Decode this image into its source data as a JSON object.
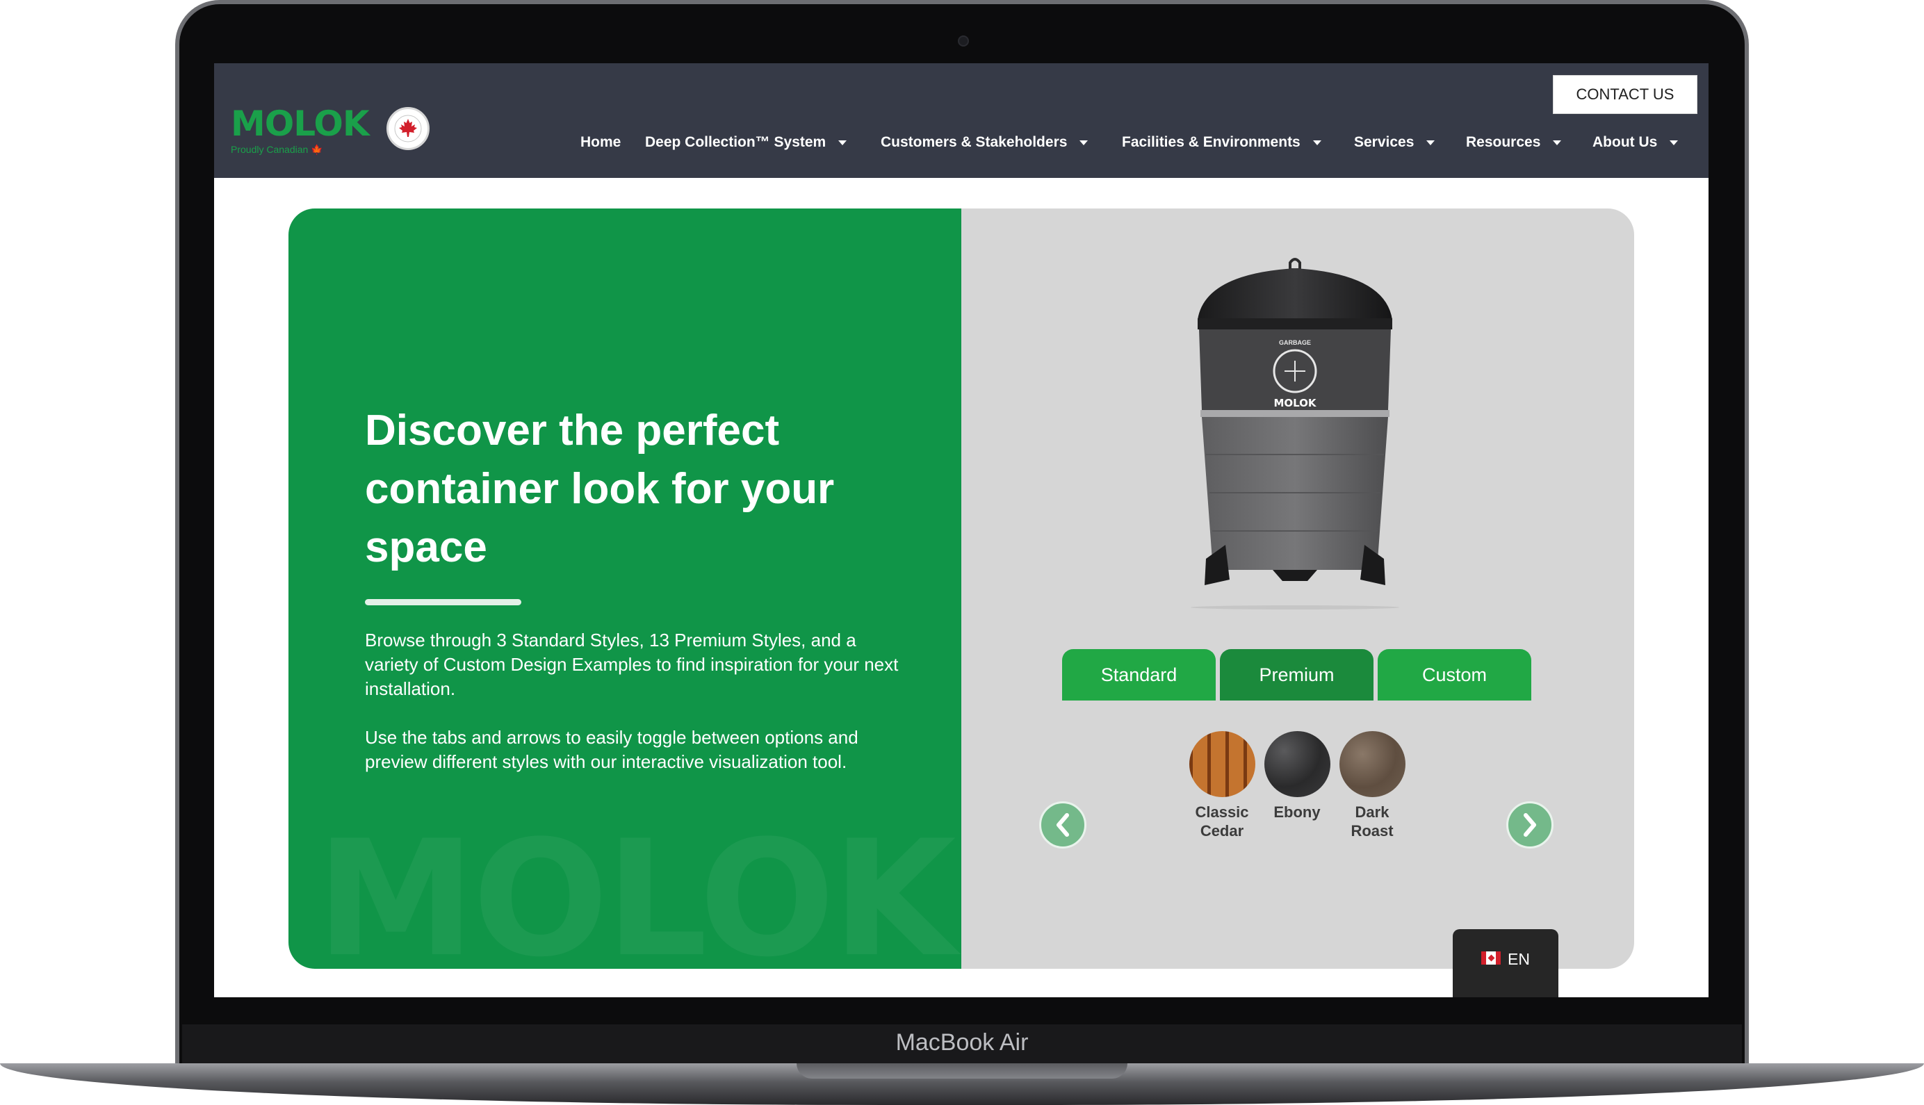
{
  "device": {
    "model": "MacBook Air"
  },
  "brand": {
    "logo_text": "MOLOK",
    "tagline": "Proudly Canadian"
  },
  "header": {
    "contact_label": "CONTACT US",
    "nav": [
      {
        "label": "Home",
        "dropdown": false
      },
      {
        "label": "Deep Collection™ System",
        "dropdown": true
      },
      {
        "label": "Customers & Stakeholders",
        "dropdown": true
      },
      {
        "label": "Facilities & Environments",
        "dropdown": true
      },
      {
        "label": "Services",
        "dropdown": true
      },
      {
        "label": "Resources",
        "dropdown": true
      },
      {
        "label": "About Us",
        "dropdown": true
      }
    ]
  },
  "hero": {
    "title": "Discover the perfect container look for your space",
    "paragraph1": "Browse through 3 Standard Styles, 13 Premium Styles, and a variety of Custom Design Examples to find inspiration for your next installation.",
    "paragraph2": "Use the tabs and arrows to easily toggle between options and preview different styles with our interactive visualization tool."
  },
  "visualizer": {
    "container_label": "GARBAGE",
    "container_brand": "MOLOK",
    "tabs": [
      {
        "label": "Standard",
        "active": false
      },
      {
        "label": "Premium",
        "active": true
      },
      {
        "label": "Custom",
        "active": false
      }
    ],
    "swatches": [
      {
        "name": "Classic Cedar",
        "color": "#b86a2a"
      },
      {
        "name": "Ebony",
        "color": "#3a3a3a"
      },
      {
        "name": "Dark Roast",
        "color": "#6b5a4a"
      }
    ]
  },
  "language": {
    "code": "EN"
  },
  "colors": {
    "header": "#363a47",
    "green": "#109548",
    "tab": "#21a845",
    "tab_active": "#1b8a3c",
    "panel": "#d6d6d6"
  }
}
